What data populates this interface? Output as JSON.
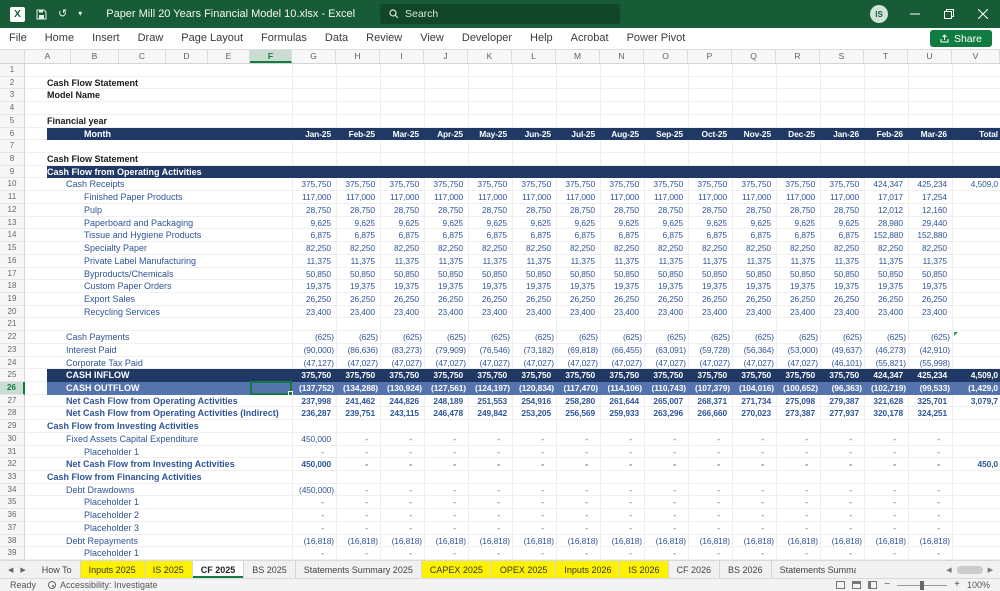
{
  "colors": {
    "title_green": "#185C37",
    "accent": "#107C41",
    "banner_navy": "#1F3864",
    "banner_blue": "#5573AD",
    "cell_text_blue": "#2F5597",
    "tab_yellow": "#FFF200"
  },
  "titlebar": {
    "title": "Paper Mill 20 Years Financial Model 10.xlsx - Excel",
    "search_placeholder": "Search",
    "user_initials": "IS"
  },
  "ribbon": {
    "tabs": [
      "File",
      "Home",
      "Insert",
      "Draw",
      "Page Layout",
      "Formulas",
      "Data",
      "Review",
      "View",
      "Developer",
      "Help",
      "Acrobat",
      "Power Pivot"
    ],
    "share_label": "Share"
  },
  "sheet": {
    "column_letters": [
      "A",
      "B",
      "C",
      "D",
      "E",
      "F",
      "G",
      "H",
      "I",
      "J",
      "K",
      "L",
      "M",
      "N",
      "O",
      "P",
      "Q",
      "R",
      "S",
      "T",
      "U",
      "V"
    ],
    "selected": {
      "column": "F",
      "row": 26,
      "cell": "F26"
    },
    "rows": [
      {},
      {
        "label": "Cash Flow Statement",
        "style": "title",
        "indent": 0
      },
      {
        "label": "Model Name",
        "style": "title",
        "indent": 0
      },
      {},
      {
        "label": "Financial year",
        "style": "title",
        "indent": 0
      },
      {
        "label": "Month",
        "style": "banner",
        "indent": 2,
        "cells": [
          "Jan-25",
          "Feb-25",
          "Mar-25",
          "Apr-25",
          "May-25",
          "Jun-25",
          "Jul-25",
          "Aug-25",
          "Sep-25",
          "Oct-25",
          "Nov-25",
          "Dec-25",
          "Jan-26",
          "Feb-26",
          "Mar-26",
          "Total"
        ]
      },
      {},
      {
        "label": "Cash Flow Statement",
        "style": "title",
        "indent": 0
      },
      {
        "label": "Cash Flow from Operating Activities",
        "style": "banner",
        "indent": 0
      },
      {
        "label": "Cash Receipts",
        "indent": 1,
        "cells": [
          "375,750",
          "375,750",
          "375,750",
          "375,750",
          "375,750",
          "375,750",
          "375,750",
          "375,750",
          "375,750",
          "375,750",
          "375,750",
          "375,750",
          "375,750",
          "424,347",
          "425,234",
          "4,509,0"
        ]
      },
      {
        "label": "Finished Paper Products",
        "indent": 2,
        "cells": [
          "117,000",
          "117,000",
          "117,000",
          "117,000",
          "117,000",
          "117,000",
          "117,000",
          "117,000",
          "117,000",
          "117,000",
          "117,000",
          "117,000",
          "117,000",
          "17,017",
          "17,254",
          ""
        ]
      },
      {
        "label": "Pulp",
        "indent": 2,
        "cells": [
          "28,750",
          "28,750",
          "28,750",
          "28,750",
          "28,750",
          "28,750",
          "28,750",
          "28,750",
          "28,750",
          "28,750",
          "28,750",
          "28,750",
          "28,750",
          "12,012",
          "12,160",
          ""
        ]
      },
      {
        "label": "Paperboard and Packaging",
        "indent": 2,
        "cells": [
          "9,625",
          "9,625",
          "9,625",
          "9,625",
          "9,625",
          "9,625",
          "9,625",
          "9,625",
          "9,625",
          "9,625",
          "9,625",
          "9,625",
          "9,625",
          "28,980",
          "29,440",
          ""
        ]
      },
      {
        "label": "Tissue and Hygiene Products",
        "indent": 2,
        "cells": [
          "6,875",
          "6,875",
          "6,875",
          "6,875",
          "6,875",
          "6,875",
          "6,875",
          "6,875",
          "6,875",
          "6,875",
          "6,875",
          "6,875",
          "6,875",
          "152,880",
          "152,880",
          ""
        ]
      },
      {
        "label": "Specialty Paper",
        "indent": 2,
        "cells": [
          "82,250",
          "82,250",
          "82,250",
          "82,250",
          "82,250",
          "82,250",
          "82,250",
          "82,250",
          "82,250",
          "82,250",
          "82,250",
          "82,250",
          "82,250",
          "82,250",
          "82,250",
          ""
        ]
      },
      {
        "label": "Private Label Manufacturing",
        "indent": 2,
        "cells": [
          "11,375",
          "11,375",
          "11,375",
          "11,375",
          "11,375",
          "11,375",
          "11,375",
          "11,375",
          "11,375",
          "11,375",
          "11,375",
          "11,375",
          "11,375",
          "11,375",
          "11,375",
          ""
        ]
      },
      {
        "label": "Byproducts/Chemicals",
        "indent": 2,
        "cells": [
          "50,850",
          "50,850",
          "50,850",
          "50,850",
          "50,850",
          "50,850",
          "50,850",
          "50,850",
          "50,850",
          "50,850",
          "50,850",
          "50,850",
          "50,850",
          "50,850",
          "50,850",
          ""
        ]
      },
      {
        "label": "Custom Paper Orders",
        "indent": 2,
        "cells": [
          "19,375",
          "19,375",
          "19,375",
          "19,375",
          "19,375",
          "19,375",
          "19,375",
          "19,375",
          "19,375",
          "19,375",
          "19,375",
          "19,375",
          "19,375",
          "19,375",
          "19,375",
          ""
        ]
      },
      {
        "label": "Export Sales",
        "indent": 2,
        "cells": [
          "26,250",
          "26,250",
          "26,250",
          "26,250",
          "26,250",
          "26,250",
          "26,250",
          "26,250",
          "26,250",
          "26,250",
          "26,250",
          "26,250",
          "26,250",
          "26,250",
          "26,250",
          ""
        ]
      },
      {
        "label": "Recycling Services",
        "indent": 2,
        "cells": [
          "23,400",
          "23,400",
          "23,400",
          "23,400",
          "23,400",
          "23,400",
          "23,400",
          "23,400",
          "23,400",
          "23,400",
          "23,400",
          "23,400",
          "23,400",
          "23,400",
          "23,400",
          ""
        ]
      },
      {},
      {
        "label": "Cash Payments",
        "indent": 1,
        "marker": true,
        "cells": [
          "(625)",
          "(625)",
          "(625)",
          "(625)",
          "(625)",
          "(625)",
          "(625)",
          "(625)",
          "(625)",
          "(625)",
          "(625)",
          "(625)",
          "(625)",
          "(625)",
          "(625)",
          ""
        ]
      },
      {
        "label": "Interest Paid",
        "indent": 1,
        "cells": [
          "(90,000)",
          "(86,636)",
          "(83,273)",
          "(79,909)",
          "(76,546)",
          "(73,182)",
          "(69,818)",
          "(66,455)",
          "(63,091)",
          "(59,728)",
          "(56,364)",
          "(53,000)",
          "(49,637)",
          "(46,273)",
          "(42,910)",
          ""
        ]
      },
      {
        "label": "Corporate Tax Paid",
        "indent": 1,
        "cells": [
          "(47,127)",
          "(47,027)",
          "(47,027)",
          "(47,027)",
          "(47,027)",
          "(47,027)",
          "(47,027)",
          "(47,027)",
          "(47,027)",
          "(47,027)",
          "(47,027)",
          "(47,027)",
          "(46,101)",
          "(55,821)",
          "(55,998)",
          ""
        ]
      },
      {
        "label": "CASH INFLOW",
        "style": "banner",
        "indent": 1,
        "cells": [
          "375,750",
          "375,750",
          "375,750",
          "375,750",
          "375,750",
          "375,750",
          "375,750",
          "375,750",
          "375,750",
          "375,750",
          "375,750",
          "375,750",
          "375,750",
          "424,347",
          "425,234",
          "4,509,0"
        ]
      },
      {
        "label": "CASH OUTFLOW",
        "style": "banner2",
        "indent": 1,
        "cells": [
          "(137,752)",
          "(134,288)",
          "(130,924)",
          "(127,561)",
          "(124,197)",
          "(120,834)",
          "(117,470)",
          "(114,106)",
          "(110,743)",
          "(107,379)",
          "(104,016)",
          "(100,652)",
          "(96,363)",
          "(102,719)",
          "(99,533)",
          "(1,429,0"
        ]
      },
      {
        "label": "Net Cash Flow from Operating Activities",
        "style": "totalrow",
        "indent": 1,
        "cells": [
          "237,998",
          "241,462",
          "244,826",
          "248,189",
          "251,553",
          "254,916",
          "258,280",
          "261,644",
          "265,007",
          "268,371",
          "271,734",
          "275,098",
          "279,387",
          "321,628",
          "325,701",
          "3,079,7"
        ]
      },
      {
        "label": "Net Cash Flow from Operating Activities (Indirect)",
        "style": "totalrow",
        "indent": 1,
        "cells": [
          "236,287",
          "239,751",
          "243,115",
          "246,478",
          "249,842",
          "253,205",
          "256,569",
          "259,933",
          "263,296",
          "266,660",
          "270,023",
          "273,387",
          "277,937",
          "320,178",
          "324,251",
          ""
        ]
      },
      {
        "label": "Cash Flow from Investing Activities",
        "style": "section",
        "indent": 0
      },
      {
        "label": "Fixed Assets Capital Expenditure",
        "indent": 1,
        "cells": [
          "450,000",
          "-",
          "-",
          "-",
          "-",
          "-",
          "-",
          "-",
          "-",
          "-",
          "-",
          "-",
          "-",
          "-",
          "-",
          ""
        ]
      },
      {
        "label": "Placeholder 1",
        "indent": 2,
        "cells": [
          "-",
          "-",
          "-",
          "-",
          "-",
          "-",
          "-",
          "-",
          "-",
          "-",
          "-",
          "-",
          "-",
          "-",
          "-",
          ""
        ]
      },
      {
        "label": "Net Cash Flow from Investing Activities",
        "style": "totalrow",
        "indent": 1,
        "cells": [
          "450,000",
          "-",
          "-",
          "-",
          "-",
          "-",
          "-",
          "-",
          "-",
          "-",
          "-",
          "-",
          "-",
          "-",
          "-",
          "450,0"
        ]
      },
      {
        "label": "Cash Flow from Financing Activities",
        "style": "section",
        "indent": 0
      },
      {
        "label": "Debt Drawdowns",
        "indent": 1,
        "cells": [
          "(450,000)",
          "-",
          "-",
          "-",
          "-",
          "-",
          "-",
          "-",
          "-",
          "-",
          "-",
          "-",
          "-",
          "-",
          "-",
          ""
        ]
      },
      {
        "label": "Placeholder 1",
        "indent": 2,
        "cells": [
          "-",
          "-",
          "-",
          "-",
          "-",
          "-",
          "-",
          "-",
          "-",
          "-",
          "-",
          "-",
          "-",
          "-",
          "-",
          ""
        ]
      },
      {
        "label": "Placeholder 2",
        "indent": 2,
        "cells": [
          "-",
          "-",
          "-",
          "-",
          "-",
          "-",
          "-",
          "-",
          "-",
          "-",
          "-",
          "-",
          "-",
          "-",
          "-",
          ""
        ]
      },
      {
        "label": "Placeholder 3",
        "indent": 2,
        "cells": [
          "-",
          "-",
          "-",
          "-",
          "-",
          "-",
          "-",
          "-",
          "-",
          "-",
          "-",
          "-",
          "-",
          "-",
          "-",
          ""
        ]
      },
      {
        "label": "Debt Repayments",
        "indent": 1,
        "cells": [
          "(16,818)",
          "(16,818)",
          "(16,818)",
          "(16,818)",
          "(16,818)",
          "(16,818)",
          "(16,818)",
          "(16,818)",
          "(16,818)",
          "(16,818)",
          "(16,818)",
          "(16,818)",
          "(16,818)",
          "(16,818)",
          "(16,818)",
          ""
        ]
      },
      {
        "label": "Placeholder 1",
        "indent": 2,
        "cells": [
          "-",
          "-",
          "-",
          "-",
          "-",
          "-",
          "-",
          "-",
          "-",
          "-",
          "-",
          "-",
          "-",
          "-",
          "-",
          ""
        ]
      }
    ]
  },
  "sheet_tabs": {
    "tabs": [
      {
        "label": "How To"
      },
      {
        "label": "Inputs 2025",
        "color": "yellow"
      },
      {
        "label": "IS 2025",
        "color": "yellow"
      },
      {
        "label": "CF 2025",
        "active": true
      },
      {
        "label": "BS 2025"
      },
      {
        "label": "Statements Summary 2025"
      },
      {
        "label": "CAPEX 2025",
        "color": "yellow"
      },
      {
        "label": "OPEX 2025",
        "color": "yellow"
      },
      {
        "label": "Inputs 2026",
        "color": "yellow"
      },
      {
        "label": "IS 2026",
        "color": "yellow"
      },
      {
        "label": "CF 2026"
      },
      {
        "label": "BS 2026"
      },
      {
        "label": "Statements Summa",
        "truncated": true
      }
    ]
  },
  "status_bar": {
    "ready": "Ready",
    "accessibility": "Accessibility: Investigate",
    "zoom": "100%"
  }
}
